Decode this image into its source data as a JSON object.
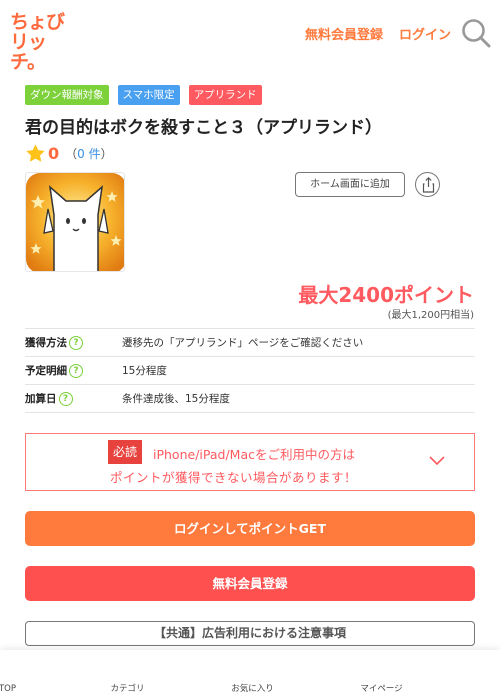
{
  "header": {
    "logo_line1": "ちょび",
    "logo_line2": "リッチ。",
    "register_link": "無料会員登録",
    "login_link": "ログイン",
    "search_icon": "search-icon"
  },
  "badges": [
    "ダウン報酬対象",
    "スマホ限定",
    "アプリランド"
  ],
  "title": "君の目的はボクを殺すこと３（アプリランド）",
  "rating": {
    "value": "0",
    "count_open": "（",
    "count": "0 件",
    "count_close": "）"
  },
  "actions": {
    "home_button": "ホーム画面に追加",
    "share_icon": "share-icon"
  },
  "points": {
    "main": "最大2400ポイント",
    "sub": "(最大1,200円相当)"
  },
  "info": [
    {
      "label": "獲得方法",
      "value": "遷移先の「アプリランド」ページをご確認ください"
    },
    {
      "label": "予定明細",
      "value": "15分程度"
    },
    {
      "label": "加算日",
      "value": "条件達成後、15分程度"
    }
  ],
  "help_mark": "?",
  "notice": {
    "tag": "必読",
    "line1": "iPhone/iPad/Macをご利用中の方は",
    "line2": "ポイントが獲得できない場合があります！"
  },
  "buttons": {
    "login": "ログインしてポイントGET",
    "register": "無料会員登録",
    "caution": "【共通】広告利用における注意事項"
  },
  "bottom_nav": [
    "TOP",
    "カテゴリ",
    "お気に入り",
    "マイページ"
  ],
  "colors": {
    "brand_orange": "#ff7a3d",
    "brand_red": "#ff5050",
    "badge_green": "#7dd13b",
    "badge_blue": "#4aa0f0",
    "badge_red": "#ff5a5f"
  }
}
